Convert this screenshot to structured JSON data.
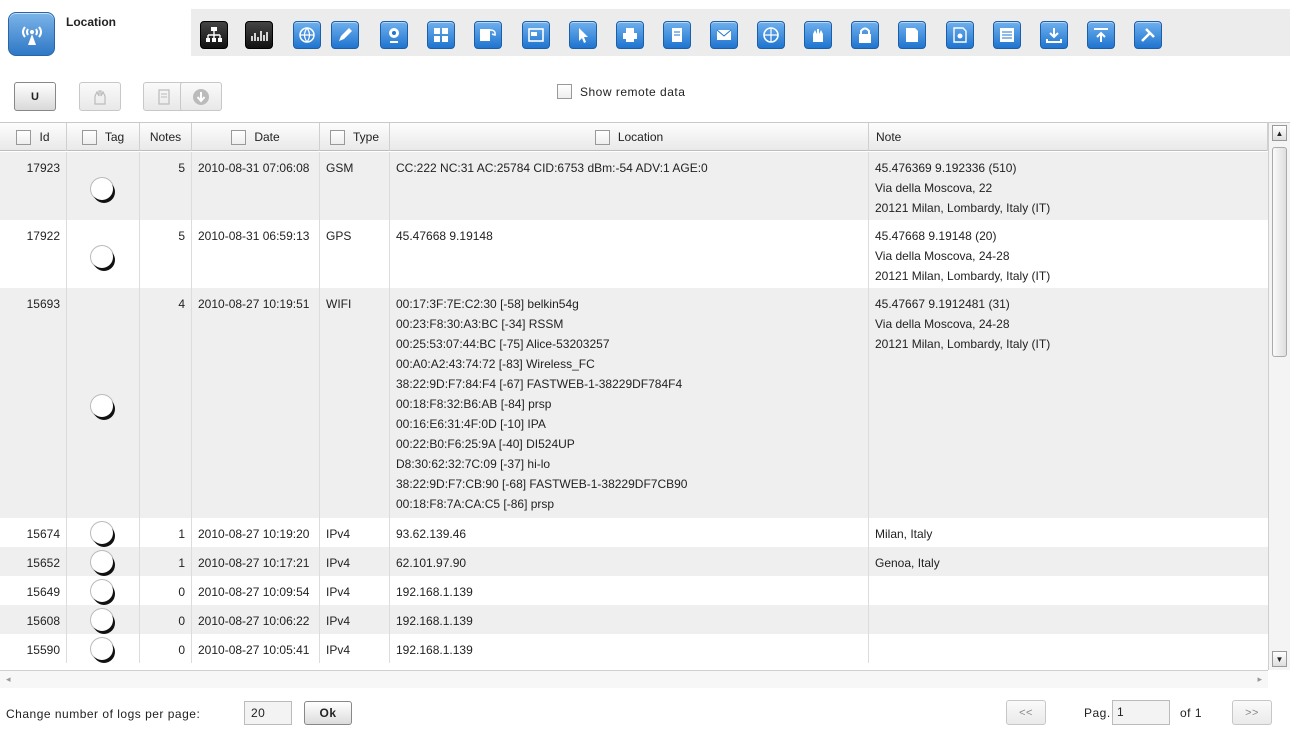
{
  "app": {
    "title": "Location",
    "icon": "antenna-icon"
  },
  "toolbar_icons": [
    {
      "name": "network-icon",
      "style": "dark"
    },
    {
      "name": "bar-chart-icon",
      "style": "dark"
    },
    {
      "name": "globe-icon",
      "style": "blue"
    },
    {
      "name": "pencil-icon",
      "style": "blue"
    },
    {
      "name": "webcam-icon",
      "style": "blue"
    },
    {
      "name": "apps-icon",
      "style": "blue"
    },
    {
      "name": "chat-icon",
      "style": "blue"
    },
    {
      "name": "window-icon",
      "style": "blue"
    },
    {
      "name": "cursor-icon",
      "style": "blue"
    },
    {
      "name": "printer-icon",
      "style": "blue"
    },
    {
      "name": "phone-book-icon",
      "style": "blue"
    },
    {
      "name": "mail-icon",
      "style": "blue"
    },
    {
      "name": "internet-icon",
      "style": "blue"
    },
    {
      "name": "hand-icon",
      "style": "blue"
    },
    {
      "name": "lock-icon",
      "style": "blue"
    },
    {
      "name": "document-icon",
      "style": "blue"
    },
    {
      "name": "file-settings-icon",
      "style": "blue"
    },
    {
      "name": "screen-icon",
      "style": "blue"
    },
    {
      "name": "download-icon",
      "style": "blue"
    },
    {
      "name": "upload-icon",
      "style": "blue"
    },
    {
      "name": "tools-icon",
      "style": "blue"
    }
  ],
  "actions": {
    "u_label": "U",
    "show_remote_label": "Show remote data"
  },
  "table": {
    "columns": {
      "id": "Id",
      "tag": "Tag",
      "notes": "Notes",
      "date": "Date",
      "type": "Type",
      "location": "Location",
      "note": "Note"
    },
    "rows": [
      {
        "id": "17923",
        "notes": "5",
        "date": "2010-08-31 07:06:08",
        "type": "GSM",
        "location": [
          "CC:222 NC:31 AC:25784 CID:6753 dBm:-54 ADV:1 AGE:0"
        ],
        "note": [
          "45.476369 9.192336 (510)",
          "Via della Moscova, 22",
          "20121 Milan, Lombardy, Italy (IT)"
        ]
      },
      {
        "id": "17922",
        "notes": "5",
        "date": "2010-08-31 06:59:13",
        "type": "GPS",
        "location": [
          "45.47668 9.19148"
        ],
        "note": [
          "45.47668 9.19148 (20)",
          "Via della Moscova, 24-28",
          "20121 Milan, Lombardy, Italy (IT)"
        ]
      },
      {
        "id": "15693",
        "notes": "4",
        "date": "2010-08-27 10:19:51",
        "type": "WIFI",
        "location": [
          "00:17:3F:7E:C2:30 [-58] belkin54g",
          "00:23:F8:30:A3:BC [-34] RSSM",
          "00:25:53:07:44:BC [-75] Alice-53203257",
          "00:A0:A2:43:74:72 [-83] Wireless_FC",
          "38:22:9D:F7:84:F4 [-67] FASTWEB-1-38229DF784F4",
          "00:18:F8:32:B6:AB [-84] prsp",
          "00:16:E6:31:4F:0D [-10] IPA",
          "00:22:B0:F6:25:9A [-40] DI524UP",
          "D8:30:62:32:7C:09 [-37] hi-lo",
          "38:22:9D:F7:CB:90 [-68] FASTWEB-1-38229DF7CB90",
          "00:18:F8:7A:CA:C5 [-86] prsp"
        ],
        "note": [
          "45.47667 9.1912481 (31)",
          "Via della Moscova, 24-28",
          "20121 Milan, Lombardy, Italy (IT)"
        ]
      },
      {
        "id": "15674",
        "notes": "1",
        "date": "2010-08-27 10:19:20",
        "type": "IPv4",
        "location": [
          "93.62.139.46"
        ],
        "note": [
          "Milan, Italy"
        ]
      },
      {
        "id": "15652",
        "notes": "1",
        "date": "2010-08-27 10:17:21",
        "type": "IPv4",
        "location": [
          "62.101.97.90"
        ],
        "note": [
          "Genoa, Italy"
        ]
      },
      {
        "id": "15649",
        "notes": "0",
        "date": "2010-08-27 10:09:54",
        "type": "IPv4",
        "location": [
          "192.168.1.139"
        ],
        "note": []
      },
      {
        "id": "15608",
        "notes": "0",
        "date": "2010-08-27 10:06:22",
        "type": "IPv4",
        "location": [
          "192.168.1.139"
        ],
        "note": []
      },
      {
        "id": "15590",
        "notes": "0",
        "date": "2010-08-27 10:05:41",
        "type": "IPv4",
        "location": [
          "192.168.1.139"
        ],
        "note": []
      }
    ]
  },
  "footer": {
    "per_page_label": "Change number of logs per page:",
    "per_page_value": "20",
    "ok_label": "Ok",
    "prev_label": "<<",
    "page_label": "Pag.",
    "page_value": "1",
    "of_label": "of 1",
    "next_label": ">>"
  }
}
